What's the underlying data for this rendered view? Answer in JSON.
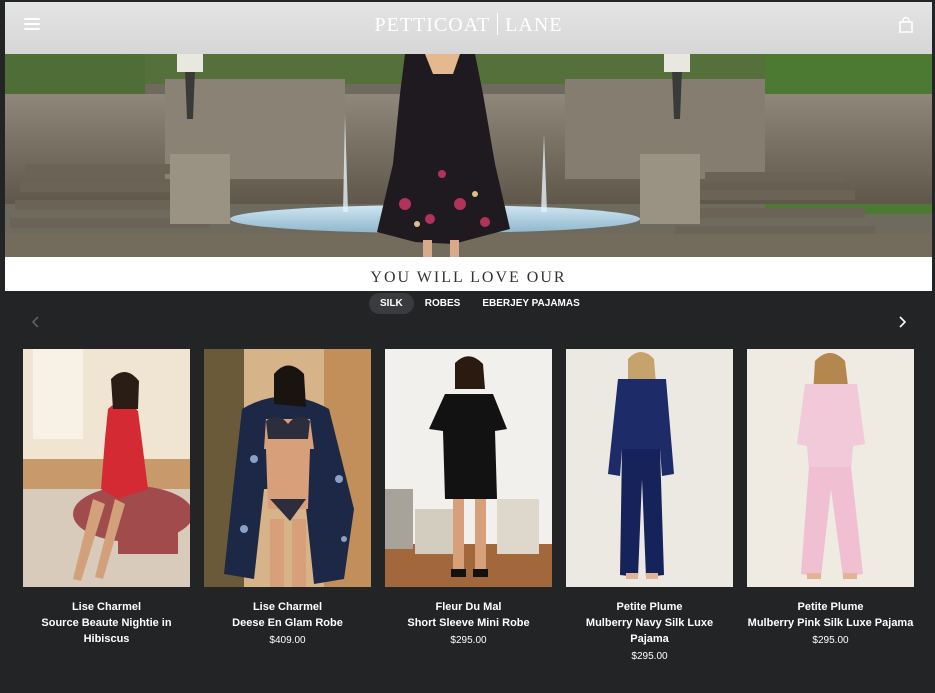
{
  "header": {
    "logo_left": "PETTICOAT",
    "logo_right": "LANE"
  },
  "section": {
    "title": "YOU WILL LOVE OUR"
  },
  "tabs": [
    {
      "label": "SILK",
      "active": true
    },
    {
      "label": "ROBES",
      "active": false
    },
    {
      "label": "EBERJEY PAJAMAS",
      "active": false
    }
  ],
  "products": [
    {
      "brand": "Lise Charmel",
      "name": "Source Beaute Nightie in Hibiscus",
      "price": ""
    },
    {
      "brand": "Lise Charmel",
      "name": "Deese En Glam Robe",
      "price": "$409.00"
    },
    {
      "brand": "Fleur Du Mal",
      "name": "Short Sleeve Mini Robe",
      "price": "$295.00"
    },
    {
      "brand": "Petite Plume",
      "name": "Mulberry Navy Silk Luxe Pajama",
      "price": "$295.00"
    },
    {
      "brand": "Petite Plume",
      "name": "Mulberry Pink Silk Luxe Pajama",
      "price": "$295.00"
    }
  ]
}
